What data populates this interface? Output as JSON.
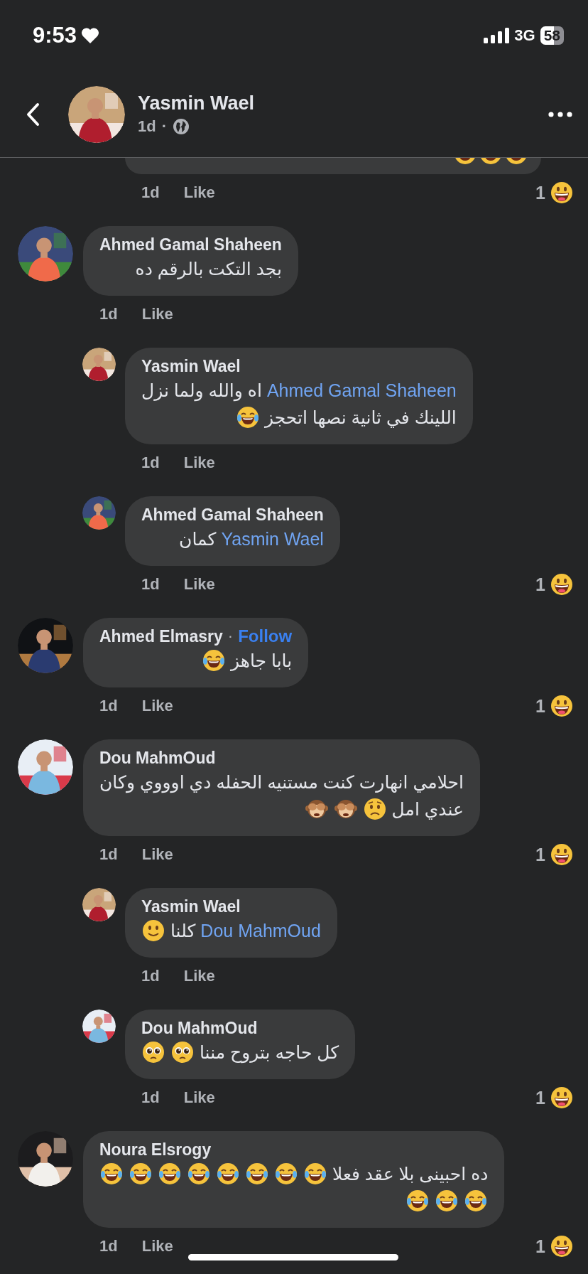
{
  "status_bar": {
    "time": "9:53",
    "network": "3G",
    "battery": "58"
  },
  "header": {
    "name": "Yasmin Wael",
    "time": "1d",
    "separator": "·"
  },
  "comments": [
    {
      "kind": "reply",
      "cut_off": true,
      "lines": [
        [
          {
            "kind": "joy"
          },
          {
            "kind": "joy"
          },
          {
            "kind": "joy"
          }
        ]
      ],
      "time": "1d",
      "like": "Like",
      "reaction_count": "1"
    },
    {
      "kind": "comment",
      "cut_off": false,
      "name": "Ahmed Gamal Shaheen",
      "lines": [
        [
          {
            "kind": "text",
            "text": "بجد التكت بالرقم ده"
          }
        ]
      ],
      "time": "1d",
      "like": "Like"
    },
    {
      "kind": "reply",
      "cut_off": false,
      "name": "Yasmin Wael",
      "lines": [
        [
          {
            "kind": "mention",
            "text": "Ahmed Gamal Shaheen"
          },
          {
            "kind": "text",
            "text": "اه والله ولما نزل"
          }
        ],
        [
          {
            "kind": "text",
            "text": "اللينك في ثانية نصها اتحجز"
          },
          {
            "kind": "joy"
          }
        ]
      ],
      "time": "1d",
      "like": "Like"
    },
    {
      "kind": "reply",
      "cut_off": false,
      "name": "Ahmed Gamal Shaheen",
      "lines": [
        [
          {
            "kind": "mention",
            "text": "Yasmin Wael"
          },
          {
            "kind": "text",
            "text": "كمان"
          }
        ]
      ],
      "time": "1d",
      "like": "Like",
      "reaction_count": "1"
    },
    {
      "kind": "comment",
      "cut_off": false,
      "name": "Ahmed Elmasry",
      "separator": "·",
      "follow": "Follow",
      "lines": [
        [
          {
            "kind": "text",
            "text": "بابا جاهز"
          },
          {
            "kind": "joy"
          }
        ]
      ],
      "time": "1d",
      "like": "Like",
      "reaction_count": "1"
    },
    {
      "kind": "comment",
      "cut_off": false,
      "name": "Dou MahmOud",
      "lines": [
        [
          {
            "kind": "text",
            "text": "احلامي  انهارت كنت مستنيه الحفله دي اوووي وكان"
          }
        ],
        [
          {
            "kind": "text",
            "text": "عندي امل"
          },
          {
            "kind": "worried"
          },
          {
            "kind": "monkey"
          },
          {
            "kind": "monkey"
          }
        ]
      ],
      "time": "1d",
      "like": "Like",
      "reaction_count": "1"
    },
    {
      "kind": "reply",
      "cut_off": false,
      "name": "Yasmin Wael",
      "lines": [
        [
          {
            "kind": "mention",
            "text": "Dou MahmOud"
          },
          {
            "kind": "text",
            "text": "كلنا"
          },
          {
            "kind": "smile"
          }
        ]
      ],
      "time": "1d",
      "like": "Like"
    },
    {
      "kind": "reply",
      "cut_off": false,
      "name": "Dou MahmOud",
      "lines": [
        [
          {
            "kind": "text",
            "text": "كل حاجه بتروح مننا"
          },
          {
            "kind": "pleading"
          },
          {
            "kind": "pleading"
          }
        ]
      ],
      "time": "1d",
      "like": "Like",
      "reaction_count": "1"
    },
    {
      "kind": "comment",
      "cut_off": false,
      "name": "Noura Elsrogy",
      "lines": [
        [
          {
            "kind": "text",
            "text": "ده احبينى بلا عقد فعلا"
          },
          {
            "kind": "joy"
          },
          {
            "kind": "joy"
          },
          {
            "kind": "joy"
          },
          {
            "kind": "joy"
          },
          {
            "kind": "joy"
          },
          {
            "kind": "joy"
          },
          {
            "kind": "joy"
          },
          {
            "kind": "joy"
          }
        ],
        [
          {
            "kind": "joy"
          },
          {
            "kind": "joy"
          },
          {
            "kind": "joy"
          }
        ]
      ],
      "time": "1d",
      "like": "Like",
      "reaction_count": "1"
    }
  ]
}
